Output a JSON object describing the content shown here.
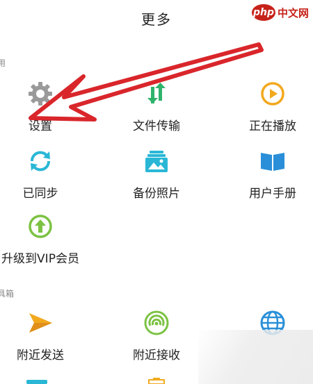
{
  "header": {
    "title": "更多"
  },
  "watermark": {
    "logo": "php",
    "text": "中文网"
  },
  "sections": [
    {
      "label": "用"
    },
    {
      "label": "具箱"
    }
  ],
  "items": [
    {
      "label": "设置",
      "icon": "gear-icon",
      "color": "#9a9a9a"
    },
    {
      "label": "文件传输",
      "icon": "transfer-arrows-icon",
      "color": "#2fb36b"
    },
    {
      "label": "正在播放",
      "icon": "play-circle-icon",
      "color": "#f2a91e"
    },
    {
      "label": "已同步",
      "icon": "sync-icon",
      "color": "#2ab7d6"
    },
    {
      "label": "备份照片",
      "icon": "photo-backup-icon",
      "color": "#2ab7d6"
    },
    {
      "label": "用户手册",
      "icon": "book-icon",
      "color": "#2a8fd8"
    },
    {
      "label": "升级到VIP会员",
      "icon": "upgrade-arrow-icon",
      "color": "#7cc243"
    },
    {
      "label": "附近发送",
      "icon": "send-icon",
      "color": "#f2a91e"
    },
    {
      "label": "附近接收",
      "icon": "receive-signal-icon",
      "color": "#7cc243"
    },
    {
      "label": "",
      "icon": "globe-icon",
      "color": "#2a8fd8"
    }
  ],
  "annotation": {
    "arrow_color": "#d9262b"
  }
}
